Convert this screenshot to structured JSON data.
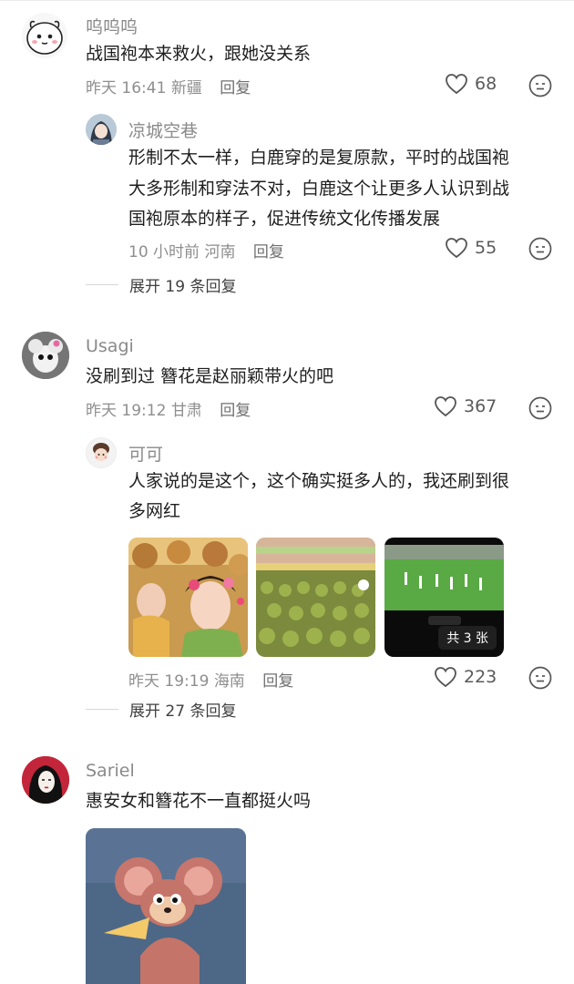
{
  "comments": [
    {
      "user": "呜呜呜",
      "text_lines": [
        "战国袍本来救火，跟她没关系"
      ],
      "time": "昨天 16:41",
      "location": "新疆",
      "reply_label": "回复",
      "likes": "68",
      "replies": [
        {
          "user": "凉城空巷",
          "text_lines": [
            "形制不太一样，白鹿穿的是复原款，平时的战国袍",
            "大多形制和穿法不对，白鹿这个让更多人认识到战",
            "国袍原本的样子，促进传统文化传播发展"
          ],
          "time": "10 小时前",
          "location": "河南",
          "reply_label": "回复",
          "likes": "55"
        }
      ],
      "expand_label": "展开 19 条回复"
    },
    {
      "user": "Usagi",
      "text_lines": [
        "没刷到过 簪花是赵丽颖带火的吧"
      ],
      "time": "昨天 19:12",
      "location": "甘肃",
      "reply_label": "回复",
      "likes": "367",
      "replies": [
        {
          "user": "可可",
          "text_lines": [
            "人家说的是这个，这个确实挺多人的，我还刷到很",
            "多网红"
          ],
          "time": "昨天 19:19",
          "location": "海南",
          "reply_label": "回复",
          "likes": "223",
          "images_badge": "共 3 张"
        }
      ],
      "expand_label": "展开 27 条回复"
    },
    {
      "user": "Sariel",
      "text_lines": [
        "惠安女和簪花不一直都挺火吗"
      ]
    }
  ],
  "icons": [
    "heart-icon",
    "more-options-icon"
  ],
  "colors": {
    "username": "#8a8a8a",
    "text": "#1e1e1e",
    "meta": "#8e8e8e"
  }
}
